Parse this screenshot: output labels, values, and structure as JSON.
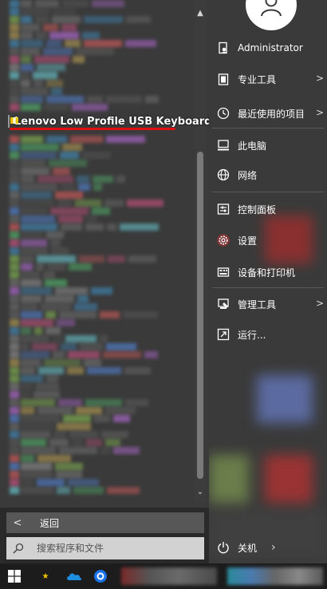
{
  "start_menu": {
    "highlighted_app": {
      "label": "Lenovo Low Profile USB Keyboard",
      "icon": "keyboard-icon"
    },
    "back": {
      "label": "返回",
      "icon": "chevron-left-icon"
    },
    "search": {
      "placeholder": "搜索程序和文件",
      "value": "",
      "icon": "search-icon"
    },
    "scrollbar": {
      "up_icon": "triangle-up-icon",
      "down_icon": "triangle-down-icon"
    },
    "annotation_color": "#e01010"
  },
  "right_menu": {
    "user": "Administrator",
    "items": [
      {
        "label": "Administrator",
        "icon": "user-doc-icon",
        "has_submenu": false
      },
      {
        "label": "专业工具",
        "icon": "tools-icon",
        "has_submenu": true
      },
      {
        "label": "最近使用的项目",
        "icon": "clock-icon",
        "has_submenu": true
      },
      {
        "label": "此电脑",
        "icon": "computer-icon",
        "has_submenu": false
      },
      {
        "label": "网络",
        "icon": "network-icon",
        "has_submenu": false
      },
      {
        "label": "控制面板",
        "icon": "control-panel-icon",
        "has_submenu": false
      },
      {
        "label": "设置",
        "icon": "gear-icon",
        "has_submenu": false
      },
      {
        "label": "设备和打印机",
        "icon": "printer-icon",
        "has_submenu": false
      },
      {
        "label": "管理工具",
        "icon": "admin-tools-icon",
        "has_submenu": true
      },
      {
        "label": "运行...",
        "icon": "run-icon",
        "has_submenu": false
      }
    ],
    "shutdown": {
      "label": "关机",
      "icon": "power-icon",
      "arrow": "›"
    }
  },
  "taskbar": {
    "items": [
      {
        "name": "windows-start",
        "icon": "windows-logo-icon"
      },
      {
        "name": "notes",
        "icon": "star-icon"
      },
      {
        "name": "onedrive",
        "icon": "cloud-icon"
      },
      {
        "name": "browser",
        "icon": "browser-icon"
      }
    ]
  }
}
